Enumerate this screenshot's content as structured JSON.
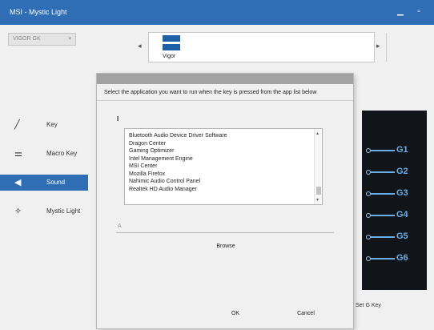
{
  "window": {
    "title": "MSI - Mystic Light",
    "minimize_icon": "minimize-icon",
    "maximize_icon": "maximize-icon",
    "accent_color": "#2f6db4"
  },
  "device_select": {
    "value": "VIGOR GK",
    "arrow_icon": "chevron-down-icon"
  },
  "thumbnails": {
    "left_arrow": "◂",
    "right_arrow": "▸",
    "items": [
      {
        "label": "Vigor",
        "icon": "keyboard-icon"
      }
    ]
  },
  "sidebar": {
    "items": [
      {
        "label": "Key",
        "icon": "pencil-icon",
        "glyph": "╱",
        "active": false
      },
      {
        "label": "Macro Key",
        "icon": "macro-icon",
        "glyph": "⚌",
        "active": false
      },
      {
        "label": "Sound",
        "icon": "speaker-icon",
        "glyph": "◀",
        "active": true
      },
      {
        "label": "Mystic Light",
        "icon": "light-icon",
        "glyph": "✧",
        "active": false
      }
    ]
  },
  "right_panel": {
    "background": "#111418",
    "line_color": "#6aaee8",
    "connectors": [
      "G1",
      "G2",
      "G3",
      "G4",
      "G5",
      "G6"
    ],
    "caption": "Set G Key"
  },
  "dialog": {
    "instruction": "Select the application you want to run when the key is pressed from the app list below",
    "search_label": "I",
    "list": [
      "Bluetooth Audio Device Driver Software",
      "Dragon Center",
      "Gaming Optimizer",
      "Intel Management Engine",
      "MSI Center",
      "Mozilla Firefox",
      "Nahimic Audio Control Panel",
      "Realtek HD Audio Manager"
    ],
    "filter_placeholder": "A",
    "browse_label": "Browse",
    "ok_label": "OK",
    "cancel_label": "Cancel"
  }
}
